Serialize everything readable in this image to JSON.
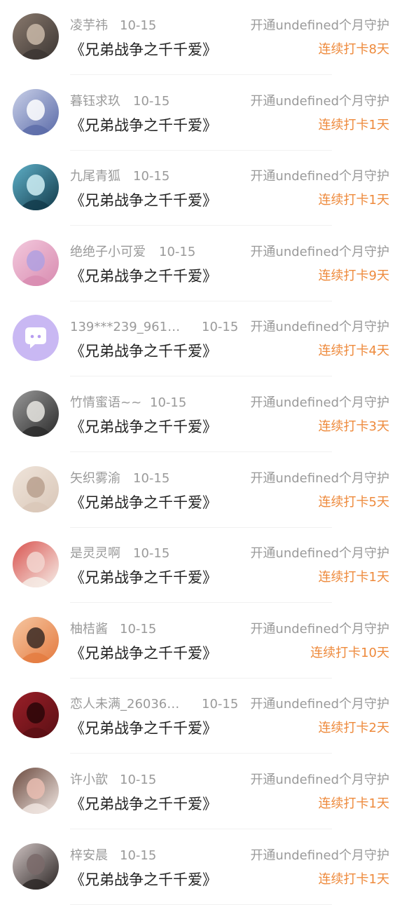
{
  "theme": {
    "accent": "#ee8a3c",
    "muted": "#9a9a9a",
    "text": "#222222"
  },
  "items": [
    {
      "name": "凌芋祎",
      "date": "10-15",
      "book": "《兄弟战争之千千爱》",
      "guard": "开通undefined个月守护",
      "streak": "连续打卡8天",
      "avatar": "avatar-photo-icon",
      "dateOffset": 171
    },
    {
      "name": "暮钰求玖",
      "date": "10-15",
      "book": "《兄弟战争之千千爱》",
      "guard": "开通undefined个月守护",
      "streak": "连续打卡1天",
      "avatar": "avatar-anime-icon",
      "dateOffset": 190
    },
    {
      "name": "九尾青狐",
      "date": "10-15",
      "book": "《兄弟战争之千千爱》",
      "guard": "开通undefined个月守护",
      "streak": "连续打卡1天",
      "avatar": "avatar-fox-icon",
      "dateOffset": 190
    },
    {
      "name": "绝绝子小可爱",
      "date": "10-15",
      "book": "《兄弟战争之千千爱》",
      "guard": "开通undefined个月守护",
      "streak": "连续打卡9天",
      "avatar": "avatar-pink-icon",
      "dateOffset": 227
    },
    {
      "name": "139***239_9619…",
      "date": "10-15",
      "book": "《兄弟战争之千千爱》",
      "guard": "开通undefined个月守护",
      "streak": "连续打卡4天",
      "avatar": "avatar-chat-icon",
      "dateOffset": 288
    },
    {
      "name": "竹情蜜语~~",
      "date": "10-15",
      "book": "《兄弟战争之千千爱》",
      "guard": "开通undefined个月守护",
      "streak": "连续打卡3天",
      "avatar": "avatar-anime-icon",
      "dateOffset": 214
    },
    {
      "name": "矢织雾渝",
      "date": "10-15",
      "book": "《兄弟战争之千千爱》",
      "guard": "开通undefined个月守护",
      "streak": "连续打卡5天",
      "avatar": "avatar-photo-icon",
      "dateOffset": 190
    },
    {
      "name": "是灵灵啊",
      "date": "10-15",
      "book": "《兄弟战争之千千爱》",
      "guard": "开通undefined个月守护",
      "streak": "连续打卡1天",
      "avatar": "avatar-red-hair-icon",
      "dateOffset": 190
    },
    {
      "name": "柚桔酱",
      "date": "10-15",
      "book": "《兄弟战争之千千爱》",
      "guard": "开通undefined个月守护",
      "streak": "连续打卡10天",
      "avatar": "avatar-orange-hair-icon",
      "dateOffset": 171
    },
    {
      "name": "恋人未满_26036…",
      "date": "10-15",
      "book": "《兄弟战争之千千爱》",
      "guard": "开通undefined个月守护",
      "streak": "连续打卡2天",
      "avatar": "avatar-roses-icon",
      "dateOffset": 288
    },
    {
      "name": "许小歆",
      "date": "10-15",
      "book": "《兄弟战争之千千爱》",
      "guard": "开通undefined个月守护",
      "streak": "连续打卡1天",
      "avatar": "avatar-girl-icon",
      "dateOffset": 171
    },
    {
      "name": "梓安晨",
      "date": "10-15",
      "book": "《兄弟战争之千千爱》",
      "guard": "开通undefined个月守护",
      "streak": "连续打卡1天",
      "avatar": "avatar-dark-girl-icon",
      "dateOffset": 171
    }
  ]
}
